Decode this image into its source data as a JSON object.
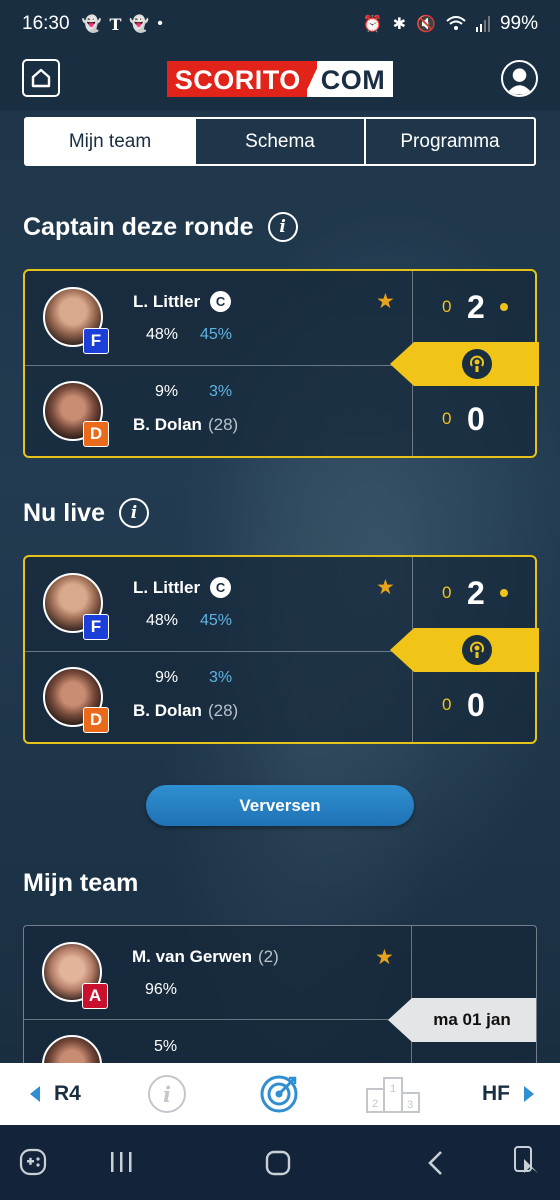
{
  "status_bar": {
    "time": "16:30",
    "battery": "99%",
    "icons": [
      "snapchat-icon",
      "newspaper-icon",
      "snapchat-icon",
      "dot-icon",
      "alarm-icon",
      "bluetooth-icon",
      "mute-icon",
      "wifi-icon",
      "signal-icon"
    ]
  },
  "header": {
    "logo_left": "SCORITO",
    "logo_right": "COM"
  },
  "tabs": [
    {
      "label": "Mijn team",
      "active": true
    },
    {
      "label": "Schema",
      "active": false
    },
    {
      "label": "Programma",
      "active": false
    }
  ],
  "captain_section": {
    "title": "Captain deze ronde",
    "player1": {
      "name": "L. Littler",
      "captain": "C",
      "badge": "F",
      "pct_owned": "48%",
      "pct_captain": "45%",
      "legs_small": "0",
      "sets": "2"
    },
    "player2": {
      "name": "B. Dolan",
      "seed": "(28)",
      "badge": "D",
      "pct_owned": "9%",
      "pct_captain": "3%",
      "legs_small": "0",
      "sets": "0"
    }
  },
  "live_section": {
    "title": "Nu live",
    "player1": {
      "name": "L. Littler",
      "captain": "C",
      "badge": "F",
      "pct_owned": "48%",
      "pct_captain": "45%",
      "legs_small": "0",
      "sets": "2"
    },
    "player2": {
      "name": "B. Dolan",
      "seed": "(28)",
      "badge": "D",
      "pct_owned": "9%",
      "pct_captain": "3%",
      "legs_small": "0",
      "sets": "0"
    }
  },
  "refresh_button": "Verversen",
  "team_section": {
    "title": "Mijn team",
    "player1": {
      "name": "M. van Gerwen",
      "seed": "(2)",
      "badge": "A",
      "pct_owned": "96%"
    },
    "player2": {
      "pct_owned": "5%"
    },
    "match_date": "ma 01 jan"
  },
  "round_bar": {
    "prev_round": "R4",
    "next_round": "HF"
  },
  "colors": {
    "accent_yellow": "#f1c518",
    "accent_blue": "#2f8fd0",
    "brand_red": "#e2231a",
    "background": "#1e3448"
  }
}
